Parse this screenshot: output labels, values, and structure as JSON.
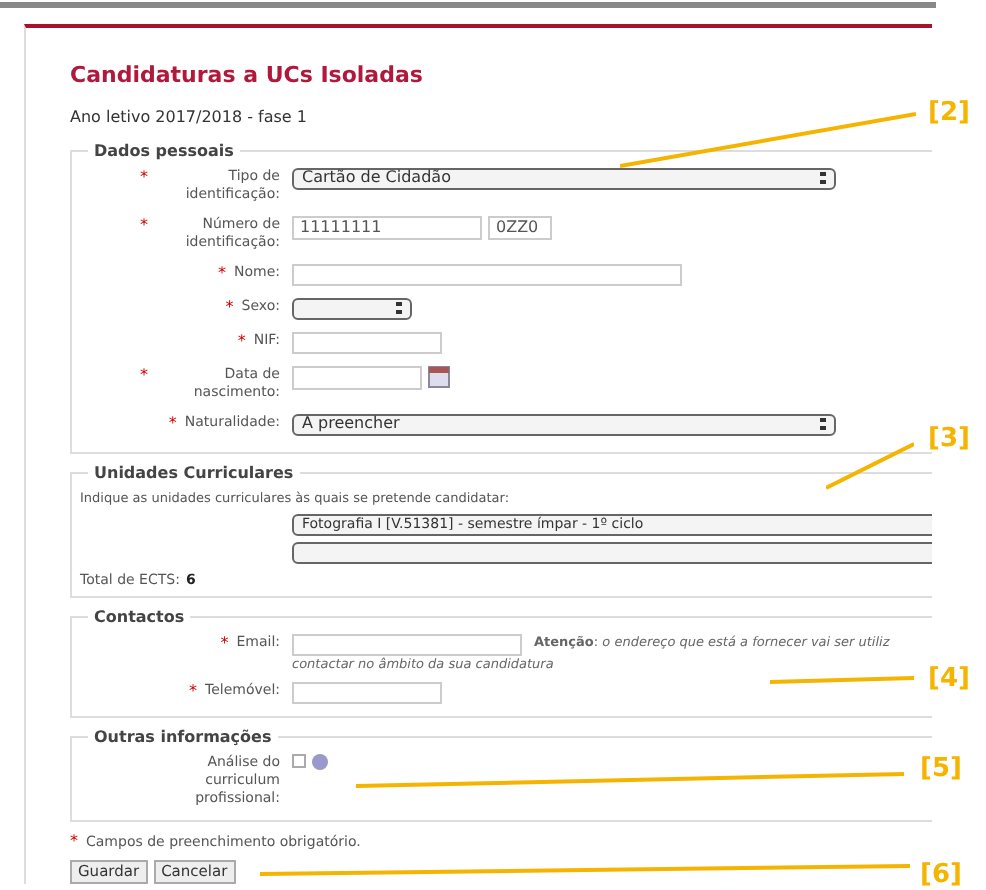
{
  "title": "Candidaturas a UCs Isoladas",
  "subtitle": "Ano letivo 2017/2018 - fase 1",
  "required_mark": "*",
  "personal": {
    "legend": "Dados pessoais",
    "fields": [
      {
        "kind": "select",
        "label": "Tipo de identificação:",
        "required": true,
        "value": "Cartão de Cidadão"
      },
      {
        "kind": "id",
        "label": "Número de identificação:",
        "required": true,
        "value": "11111111",
        "value2": "0ZZ0"
      },
      {
        "kind": "text",
        "label": "Nome:",
        "required": true
      },
      {
        "kind": "short_select",
        "label": "Sexo:",
        "required": true
      },
      {
        "kind": "short_text",
        "label": "NIF:",
        "required": true
      },
      {
        "kind": "date",
        "label": "Data de nascimento:",
        "required": true
      },
      {
        "kind": "select",
        "label": "Naturalidade:",
        "required": true,
        "value": "A preencher"
      }
    ]
  },
  "units": {
    "legend": "Unidades Curriculares",
    "hint": "Indique as unidades curriculares às quais se pretende candidatar:",
    "selects": [
      {
        "kind": "filled",
        "value": "Fotografia I [V.51381] - semestre ímpar - 1º ciclo"
      },
      {
        "kind": "empty"
      }
    ],
    "total_label": "Total de ECTS:",
    "total": "6"
  },
  "contacts": {
    "legend": "Contactos",
    "email_label": "Email:",
    "email_note": [
      "**Atenção**: *o endereço que está a fornecer vai ser utiliz*",
      "contactar no âmbito da sua candidatura"
    ],
    "phone_label": "Telemóvel:"
  },
  "other": {
    "legend": "Outras informações",
    "label": "Análise do curriculum profissional:",
    "checked": false
  },
  "required_note": "Campos de preenchimento obrigatório.",
  "buttons": [
    "Guardar",
    "Cancelar"
  ],
  "annotations": [
    "[2]",
    "[3]",
    "[4]",
    "[5]",
    "[6]"
  ]
}
